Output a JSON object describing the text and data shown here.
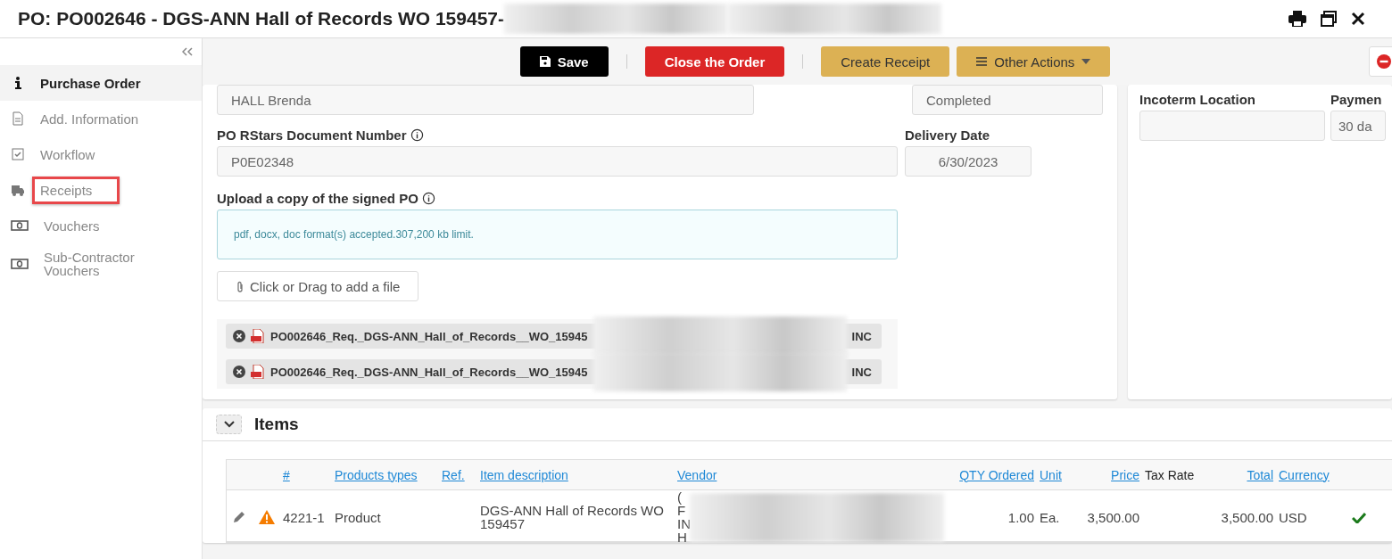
{
  "window": {
    "title": "PO: PO002646 - DGS-ANN Hall of Records WO 159457-"
  },
  "sidebar": {
    "items": [
      {
        "label": "Purchase Order",
        "selected": true,
        "highlighted": false
      },
      {
        "label": "Add. Information",
        "selected": false,
        "highlighted": false
      },
      {
        "label": "Workflow",
        "selected": false,
        "highlighted": false
      },
      {
        "label": "Receipts",
        "selected": false,
        "highlighted": true
      },
      {
        "label": "Vouchers",
        "selected": false,
        "highlighted": false
      },
      {
        "label": "Sub-Contractor Vouchers",
        "selected": false,
        "highlighted": false
      }
    ]
  },
  "toolbar": {
    "groups": [
      [
        {
          "label": "Save",
          "kind": "save"
        }
      ],
      [
        {
          "label": "Close the Order",
          "kind": "danger"
        }
      ],
      [
        {
          "label": "Create Receipt",
          "kind": "warning"
        },
        {
          "label": "Other Actions",
          "kind": "menu"
        }
      ]
    ]
  },
  "main_card": {
    "top_fields": [
      {
        "value": "HALL Brenda"
      },
      {
        "value": "Completed"
      }
    ],
    "document_number": {
      "label": "PO RStars Document Number",
      "value": "P0E02348"
    },
    "delivery_date": {
      "label": "Delivery Date",
      "value": "6/30/2023"
    },
    "upload": {
      "label": "Upload a copy of the signed PO",
      "hint": "pdf, docx, doc format(s) accepted.307,200 kb limit.",
      "button": "Click or Drag to add a file"
    },
    "files": [
      {
        "name": "PO002646_Req._DGS-ANN_Hall_of_Records__WO_15945",
        "suffix": "INC"
      },
      {
        "name": "PO002646_Req._DGS-ANN_Hall_of_Records__WO_15945",
        "suffix": "INC"
      }
    ]
  },
  "side_card": {
    "fields": [
      {
        "label": "Incoterm Location"
      },
      {
        "label": "Paymen",
        "value": "30 da"
      }
    ]
  },
  "items": {
    "title": "Items",
    "expanded": true,
    "columns": [
      {
        "label": "#",
        "link": true
      },
      {
        "label": "Products types",
        "link": true
      },
      {
        "label": "Ref.",
        "link": true
      },
      {
        "label": "Item description",
        "link": true
      },
      {
        "label": "Vendor",
        "link": true
      },
      {
        "label": "QTY Ordered",
        "link": true
      },
      {
        "label": "Unit",
        "link": true
      },
      {
        "label": "Price",
        "link": true
      },
      {
        "label": "Tax Rate",
        "link": false
      },
      {
        "label": "Total",
        "link": true
      },
      {
        "label": "Currency",
        "link": true
      }
    ],
    "rows": [
      {
        "warning": true,
        "valid": true,
        "cells": [
          "4221-1",
          "Product",
          "",
          "DGS-ANN Hall of Records WO 159457",
          "( F IN H",
          "1.00",
          "Ea.",
          "3,500.00",
          "",
          "3,500.00",
          "USD"
        ]
      }
    ]
  }
}
